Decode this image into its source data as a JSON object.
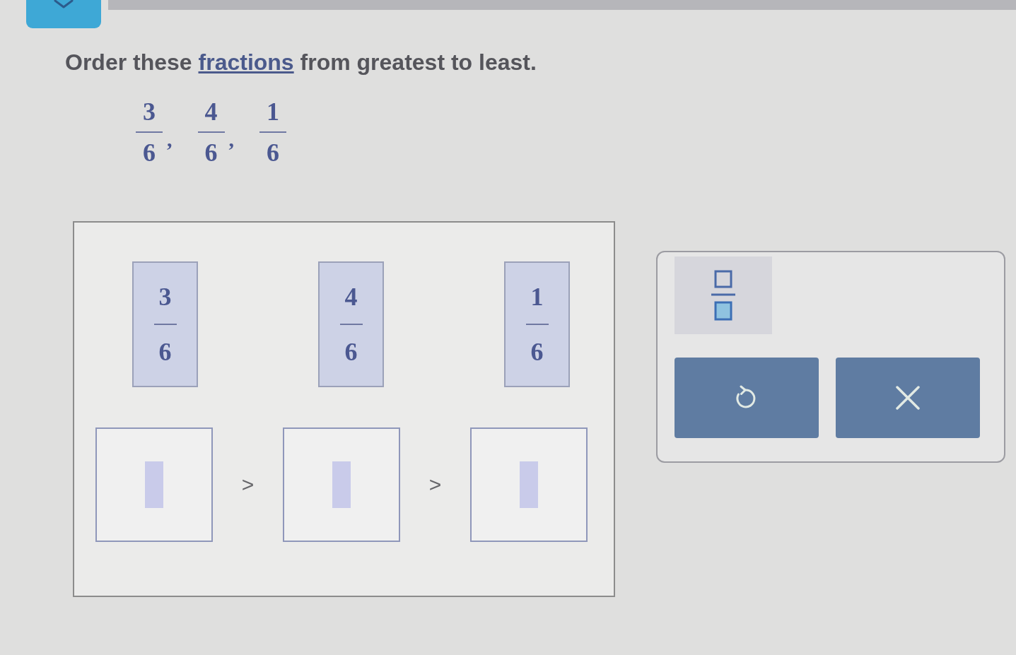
{
  "prompt": {
    "before": "Order these",
    "link": "fractions",
    "after": "from greatest to least."
  },
  "given_fractions": [
    {
      "numerator": "3",
      "denominator": "6",
      "separator": ","
    },
    {
      "numerator": "4",
      "denominator": "6",
      "separator": ","
    },
    {
      "numerator": "1",
      "denominator": "6"
    }
  ],
  "workspace": {
    "tiles": [
      {
        "numerator": "3",
        "denominator": "6"
      },
      {
        "numerator": "4",
        "denominator": "6"
      },
      {
        "numerator": "1",
        "denominator": "6"
      }
    ],
    "answer_row": [
      {
        "kind": "slot"
      },
      {
        "kind": "sign",
        "text": ">"
      },
      {
        "kind": "slot"
      },
      {
        "kind": "sign",
        "text": ">"
      },
      {
        "kind": "slot"
      }
    ]
  },
  "tools": {
    "buttons": [
      {
        "kind": "fraction"
      },
      {
        "kind": "undo"
      },
      {
        "kind": "clear"
      }
    ]
  }
}
